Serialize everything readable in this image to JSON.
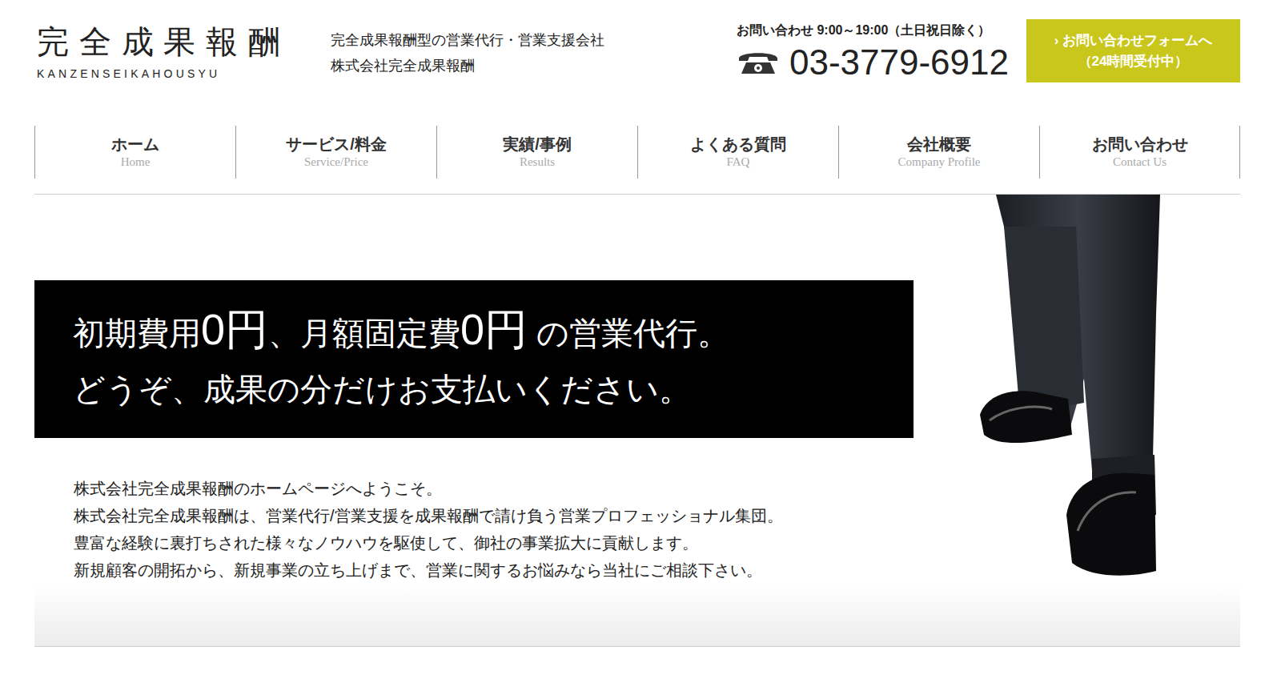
{
  "header": {
    "logo": "完全成果報酬",
    "logo_roman": "KANZENSEIKAHOUSYU",
    "tagline": [
      "完全成果報酬型の営業代行・営業支援会社",
      "株式会社完全成果報酬"
    ],
    "contact_hours": "お問い合わせ 9:00～19:00（土日祝日除く）",
    "phone": "03-3779-6912",
    "form_button": {
      "arrow": "›",
      "label": "お問い合わせフォームへ",
      "note": "（24時間受付中）"
    }
  },
  "nav": [
    {
      "label": "ホーム",
      "sub": "Home"
    },
    {
      "label": "サービス/料金",
      "sub": "Service/Price"
    },
    {
      "label": "実績/事例",
      "sub": "Results"
    },
    {
      "label": "よくある質問",
      "sub": "FAQ"
    },
    {
      "label": "会社概要",
      "sub": "Company Profile"
    },
    {
      "label": "お問い合わせ",
      "sub": "Contact Us"
    }
  ],
  "hero": {
    "line1": [
      {
        "text": "初期費用",
        "kind": "normal"
      },
      {
        "text": "0円",
        "kind": "big"
      },
      {
        "text": "、月額固定費",
        "kind": "normal"
      },
      {
        "text": "0円",
        "kind": "big"
      },
      {
        "text": " の営業代行。",
        "kind": "normal"
      }
    ],
    "line2": "どうぞ、成果の分だけお支払いください。"
  },
  "intro": [
    "株式会社完全成果報酬のホームページへようこそ。",
    "株式会社完全成果報酬は、営業代行/営業支援を成果報酬で請け負う営業プロフェッショナル集団。",
    "豊富な経験に裏打ちされた様々なノウハウを駆使して、御社の事業拡大に貢献します。",
    "新規顧客の開拓から、新規事業の立ち上げまで、営業に関するお悩みなら当社にご相談下さい。"
  ]
}
